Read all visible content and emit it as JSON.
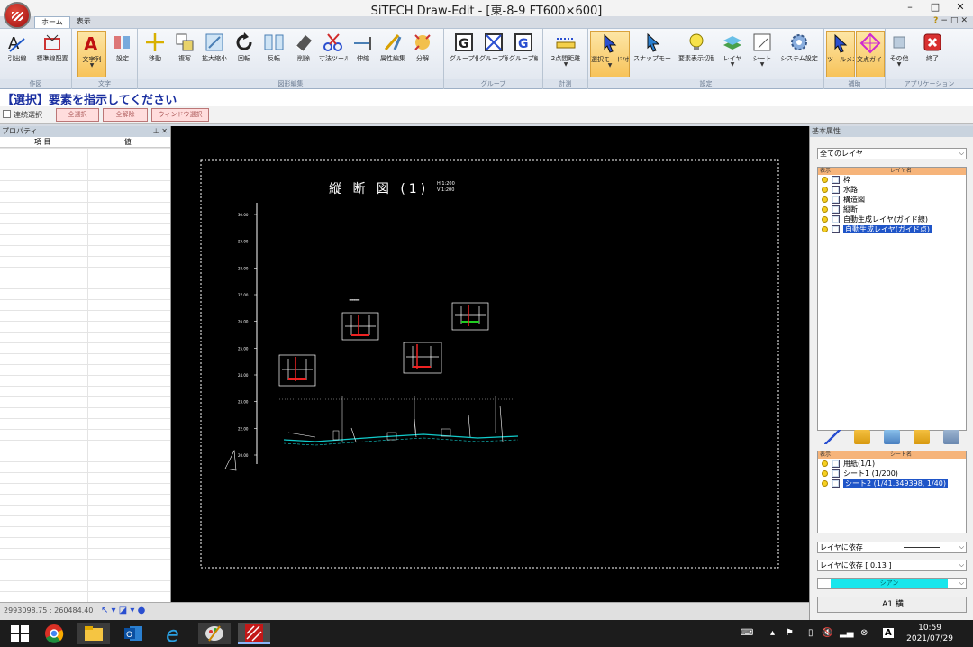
{
  "window": {
    "title": "SiTECH Draw-Edit - [東-8-9 FT600×600]",
    "controls": [
      "–",
      "□",
      "✕"
    ]
  },
  "tabs": [
    {
      "label": "ホーム",
      "active": true
    },
    {
      "label": "表示",
      "active": false
    }
  ],
  "help": {
    "q": "?",
    "items": [
      "−",
      "□",
      "✕"
    ]
  },
  "ribbon": {
    "groups": [
      {
        "label": "作図",
        "buttons": [
          "引出線",
          "標準線配置"
        ]
      },
      {
        "label": "文字",
        "buttons": [
          "文字列",
          "設定"
        ]
      },
      {
        "label": "図形編集",
        "buttons": [
          "移動",
          "複写",
          "拡大縮小",
          "回転",
          "反転",
          "削除",
          "寸法ツール",
          "伸縮",
          "属性編集",
          "分解"
        ]
      },
      {
        "label": "グループ",
        "buttons": [
          "グループ化",
          "グループ解除",
          "グループ編集"
        ]
      },
      {
        "label": "計測",
        "buttons": [
          "2点間距離"
        ]
      },
      {
        "label": "設定",
        "buttons": [
          "選択モード/ポイント",
          "スナップモード",
          "要素表示切替",
          "レイヤ",
          "シート",
          "システム設定"
        ]
      },
      {
        "label": "補助",
        "buttons": [
          "ツールメニュー",
          "交点ガイド"
        ]
      },
      {
        "label": "アプリケーション",
        "buttons": [
          "その他",
          "終了"
        ]
      }
    ]
  },
  "command": "【選択】要素を指示してください",
  "options": {
    "checkbox": "連続選択",
    "buttons": [
      "全選択",
      "全解除",
      "ウィンドウ選択"
    ]
  },
  "properties": {
    "title": "プロパティ",
    "columns": [
      "項 目",
      "値"
    ]
  },
  "drawing": {
    "title": "縦 断 図 (1)",
    "scale_h": "H 1:200",
    "scale_v": "V 1:200",
    "ylabels": [
      "30.00",
      "29.00",
      "28.00",
      "27.00",
      "26.00",
      "25.00",
      "24.00",
      "23.00",
      "22.00",
      "20.00"
    ]
  },
  "layers": {
    "title": "基本属性",
    "filter": "全てのレイヤ",
    "header": [
      "表示",
      "レイヤ名"
    ],
    "items": [
      {
        "name": "枠",
        "selected": false
      },
      {
        "name": "水路",
        "selected": false
      },
      {
        "name": "構造図",
        "selected": false
      },
      {
        "name": "縦断",
        "selected": false
      },
      {
        "name": "自動生成レイヤ(ガイド線)",
        "selected": false
      },
      {
        "name": "自動生成レイヤ(ガイド点)",
        "selected": true
      }
    ]
  },
  "sheets": {
    "header": [
      "表示",
      "シート名"
    ],
    "items": [
      {
        "name": "用紙(1/1)",
        "selected": false
      },
      {
        "name": "シート1 (1/200)",
        "selected": false
      },
      {
        "name": "シート2 (1/41.349398, 1/40)",
        "selected": true
      }
    ]
  },
  "attrs": {
    "linetype": "レイヤに依存",
    "linewidth": "レイヤに依存 [ 0.13 ]",
    "color": "シアン",
    "colorhex": "#18e6ec",
    "paper": "A1 横"
  },
  "status": {
    "coords": "2993098.75 : 260484.40"
  },
  "taskbar": {
    "time": "10:59",
    "date": "2021/07/29"
  }
}
